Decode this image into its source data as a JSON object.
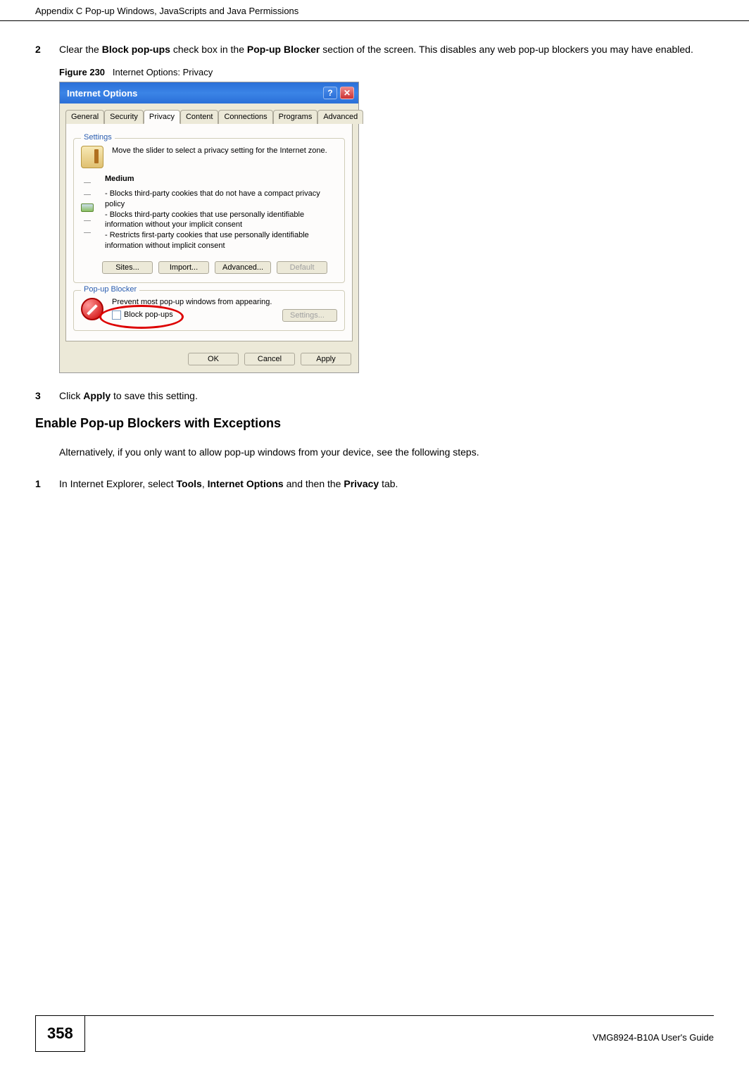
{
  "header": {
    "title": "Appendix C Pop-up Windows, JavaScripts and Java Permissions"
  },
  "step2": {
    "num": "2",
    "pre": "Clear the ",
    "bold1": "Block pop-ups",
    "mid1": " check box in the ",
    "bold2": "Pop-up Blocker",
    "post": " section of the screen. This disables any web pop-up blockers you may have enabled."
  },
  "figure_caption": {
    "label": "Figure 230",
    "text": "Internet Options: Privacy"
  },
  "dialog": {
    "title": "Internet Options",
    "tabs": [
      "General",
      "Security",
      "Privacy",
      "Content",
      "Connections",
      "Programs",
      "Advanced"
    ],
    "active_tab_index": 2,
    "settings": {
      "label": "Settings",
      "intro": "Move the slider to select a privacy setting for the Internet zone.",
      "level": "Medium",
      "bullets": [
        "- Blocks third-party cookies that do not have a compact privacy policy",
        "- Blocks third-party cookies that use personally identifiable information without your implicit consent",
        "- Restricts first-party cookies that use personally identifiable information without implicit consent"
      ],
      "buttons": {
        "sites": "Sites...",
        "import": "Import...",
        "advanced": "Advanced...",
        "default": "Default"
      }
    },
    "popup": {
      "label": "Pop-up Blocker",
      "intro": "Prevent most pop-up windows from appearing.",
      "checkbox_label": "Block pop-ups",
      "settings_btn": "Settings..."
    },
    "bottom_buttons": {
      "ok": "OK",
      "cancel": "Cancel",
      "apply": "Apply"
    }
  },
  "step3": {
    "num": "3",
    "pre": "Click ",
    "bold1": "Apply",
    "post": " to save this setting."
  },
  "section_heading": "Enable Pop-up Blockers with Exceptions",
  "section_para": "Alternatively, if you only want to allow pop-up windows from your device, see the following steps.",
  "step1b": {
    "num": "1",
    "pre": "In Internet Explorer, select ",
    "bold1": "Tools",
    "sep1": ", ",
    "bold2": "Internet Options",
    "mid": " and then the ",
    "bold3": "Privacy",
    "post": " tab."
  },
  "footer": {
    "page": "358",
    "guide": "VMG8924-B10A User's Guide"
  }
}
